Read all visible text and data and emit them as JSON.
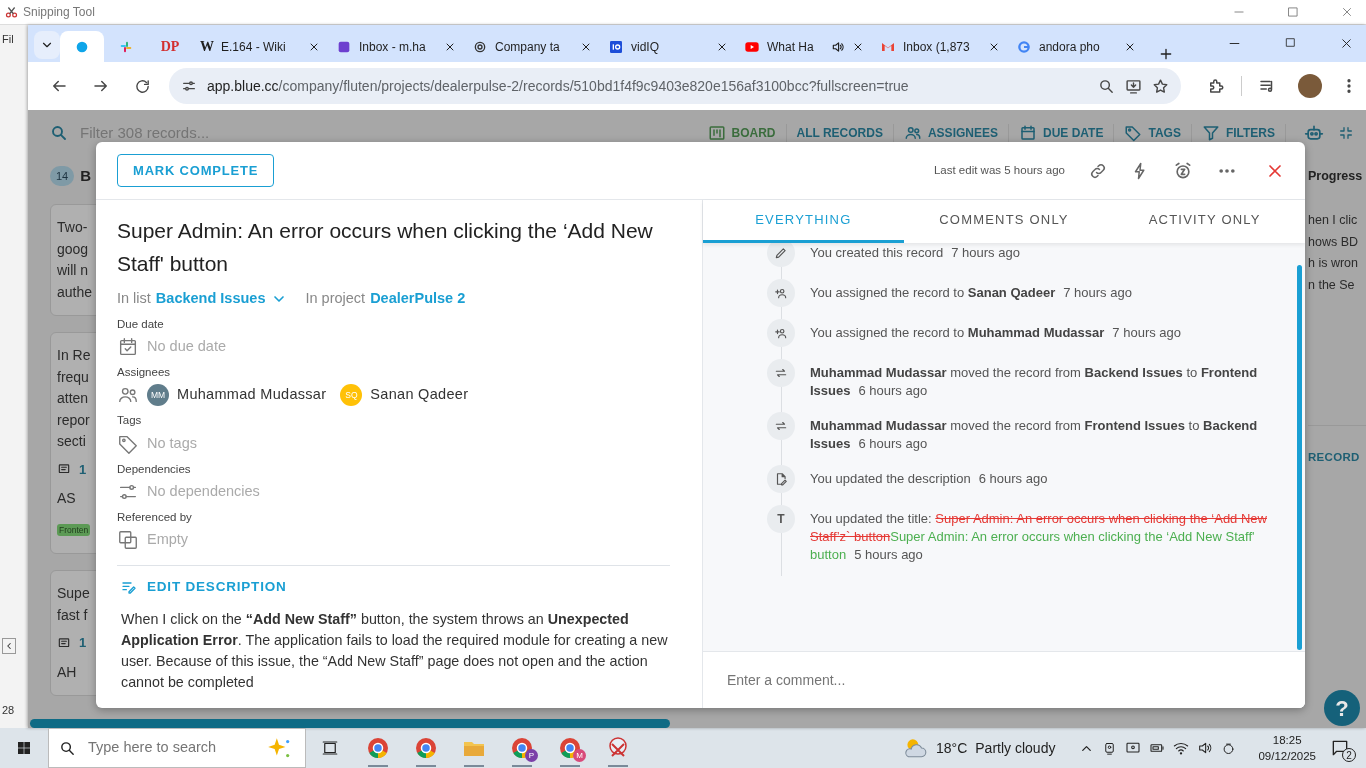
{
  "snipping_tool": {
    "title": "Snipping Tool",
    "side_texts": [
      "Fil",
      "28"
    ]
  },
  "browser": {
    "tabs": [
      {
        "kind": "dot",
        "selected": true
      },
      {
        "kind": "slack",
        "selected": false
      },
      {
        "kind": "monogram",
        "icon_text": "DP",
        "color": "#d32f2f",
        "selected": false
      },
      {
        "kind": "monogram",
        "icon_text": "W",
        "color": "#202020",
        "title": "E.164 - Wiki",
        "selected": false
      },
      {
        "kind": "hackmd",
        "title": "Inbox - m.ha",
        "selected": false
      },
      {
        "kind": "knot",
        "title": "Company ta",
        "selected": false
      },
      {
        "kind": "vidiq",
        "title": "vidIQ",
        "selected": false
      },
      {
        "kind": "youtube",
        "title": "What Ha",
        "audio": true,
        "selected": false
      },
      {
        "kind": "gmail",
        "title": "Inbox (1,873",
        "selected": false
      },
      {
        "kind": "google",
        "title": "andora pho",
        "selected": false
      }
    ],
    "url_host": "app.blue.cc",
    "url_path": "/company/fluten/projects/dealerpulse-2/records/510bd1f4f9c9403e820e156af3100bcc?fullscreen=true"
  },
  "board": {
    "search_placeholder": "Filter 308 records...",
    "toolbar": [
      {
        "label": "BOARD",
        "kind": "board",
        "selected": true
      },
      {
        "label": "ALL RECORDS",
        "selected": false
      },
      {
        "label": "ASSIGNEES",
        "kind": "people",
        "selected": false
      },
      {
        "label": "DUE DATE",
        "kind": "calendar",
        "selected": false
      },
      {
        "label": "TAGS",
        "kind": "tag",
        "selected": false
      },
      {
        "label": "FILTERS",
        "kind": "filter",
        "selected": false
      }
    ],
    "left_column": {
      "count": "14",
      "title": "B",
      "cards": [
        {
          "lines": [
            "Two-",
            "goog",
            "will n",
            "authe"
          ]
        },
        {
          "lines": [
            "In Re",
            "frequ",
            "atten",
            "repor",
            "secti"
          ],
          "comments": "1",
          "avatars": [
            "AS"
          ],
          "tag": "Fronten"
        },
        {
          "lines": [
            "Supe",
            "fast f"
          ],
          "comments": "1",
          "avatars": [
            "AH"
          ]
        }
      ]
    },
    "right_column": {
      "title": "Progress",
      "cards": [
        {
          "lines": [
            "hen I clic",
            "hows BD",
            "h is wron",
            "n the Se"
          ]
        }
      ],
      "link": "RECORD"
    },
    "help_button": "?"
  },
  "modal": {
    "mark_complete": "MARK COMPLETE",
    "last_edit": "Last edit was 5 hours ago",
    "title": "Super Admin: An error occurs when clicking the ‘Add New Staff' button",
    "list_label": "In list",
    "list": "Backend Issues",
    "project_label": "In project",
    "project": "DealerPulse 2",
    "fields": [
      {
        "label": "Due date",
        "kind": "date",
        "value": "No due date"
      },
      {
        "label": "Assignees",
        "kind": "assignees",
        "assignees": [
          {
            "initials": "MM",
            "name": "Muhammad Mudassar",
            "color": "#607d8b"
          },
          {
            "initials": "SQ",
            "name": "Sanan Qadeer",
            "color": "#ffc107"
          }
        ]
      },
      {
        "label": "Tags",
        "kind": "tags",
        "value": "No tags"
      },
      {
        "label": "Dependencies",
        "kind": "dependencies",
        "value": "No dependencies"
      },
      {
        "label": "Referenced by",
        "kind": "references",
        "value": "Empty"
      }
    ],
    "edit_description": "EDIT DESCRIPTION",
    "description": "When I click on the **“Add New Staff”** button, the system throws an **Unexpected Application Error**. The application fails to load the required module for creating a new user. Because of this issue, the “Add New Staff” page does not open and the action cannot be completed",
    "tabs": [
      {
        "label": "EVERYTHING",
        "selected": true
      },
      {
        "label": "COMMENTS ONLY",
        "selected": false
      },
      {
        "label": "ACTIVITY ONLY",
        "selected": false
      }
    ],
    "activity": [
      {
        "kind": "created",
        "text": "You created this record",
        "time": "7 hours ago"
      },
      {
        "kind": "assigned",
        "text": "You assigned the record to **Sanan Qadeer**",
        "time": "7 hours ago"
      },
      {
        "kind": "assigned",
        "text": "You assigned the record to **Muhammad Mudassar**",
        "time": "7 hours ago"
      },
      {
        "kind": "moved",
        "text": "**Muhammad Mudassar** moved the record from **Backend Issues** to **Frontend Issues**",
        "time": "6 hours ago"
      },
      {
        "kind": "moved",
        "text": "**Muhammad Mudassar** moved the record from **Frontend Issues** to **Backend Issues**",
        "time": "6 hours ago"
      },
      {
        "kind": "description",
        "text": "You updated the description",
        "time": "6 hours ago"
      },
      {
        "kind": "title",
        "icon_text": "T",
        "text": "You updated the title:",
        "old_value": "Super Admin: An error occurs when clicking the ‘Add New Staff’z` button",
        "new_value": "Super Admin: An error occurs when clicking the ‘Add New Staff' button",
        "time": "5 hours ago"
      }
    ],
    "comment_placeholder": "Enter a comment..."
  },
  "taskbar": {
    "search_placeholder": "Type here to search",
    "apps": [
      {
        "kind": "browser"
      },
      {
        "kind": "browser"
      },
      {
        "kind": "folder"
      },
      {
        "kind": "browser",
        "badge_text": "P",
        "color": "#7b3fa8"
      },
      {
        "kind": "browser",
        "badge_text": "M",
        "color": "#d84a7a"
      },
      {
        "kind": "snipping"
      }
    ],
    "temperature": "18°C",
    "weather": "Partly cloudy",
    "time": "18:25",
    "date": "09/12/2025",
    "notifications": "2"
  }
}
